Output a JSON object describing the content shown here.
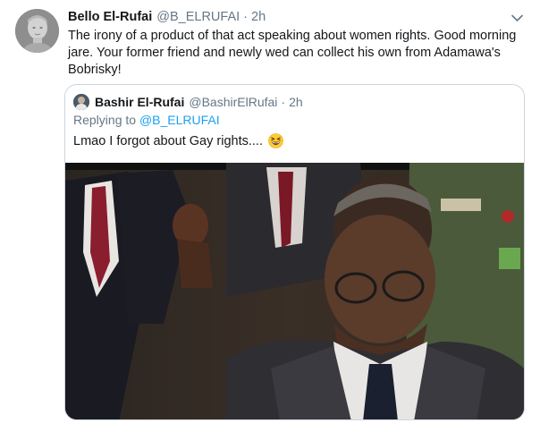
{
  "tweet": {
    "author_name": "Bello El-Rufai",
    "author_handle": "@B_ELRUFAI",
    "separator": "·",
    "time": "2h",
    "text": "The irony of a product of that act speaking about women rights. Good morning jare. Your former friend and newly wed can collect his own from Adamawa's Bobrisky!"
  },
  "quoted_tweet": {
    "author_name": "Bashir El-Rufai",
    "author_handle": "@BashirElRufai",
    "separator": "·",
    "time": "2h",
    "replying_prefix": "Replying to",
    "replying_handle": "@B_ELRUFAI",
    "text": "Lmao I forgot about Gay rights....",
    "emoji": "grinning-squinting-face-emoji"
  },
  "icons": {
    "avatar": "statue-avatar",
    "more": "chevron-down-icon"
  },
  "colors": {
    "link": "#1da1f2",
    "secondary_text": "#657786",
    "border": "#ccd6dd"
  }
}
